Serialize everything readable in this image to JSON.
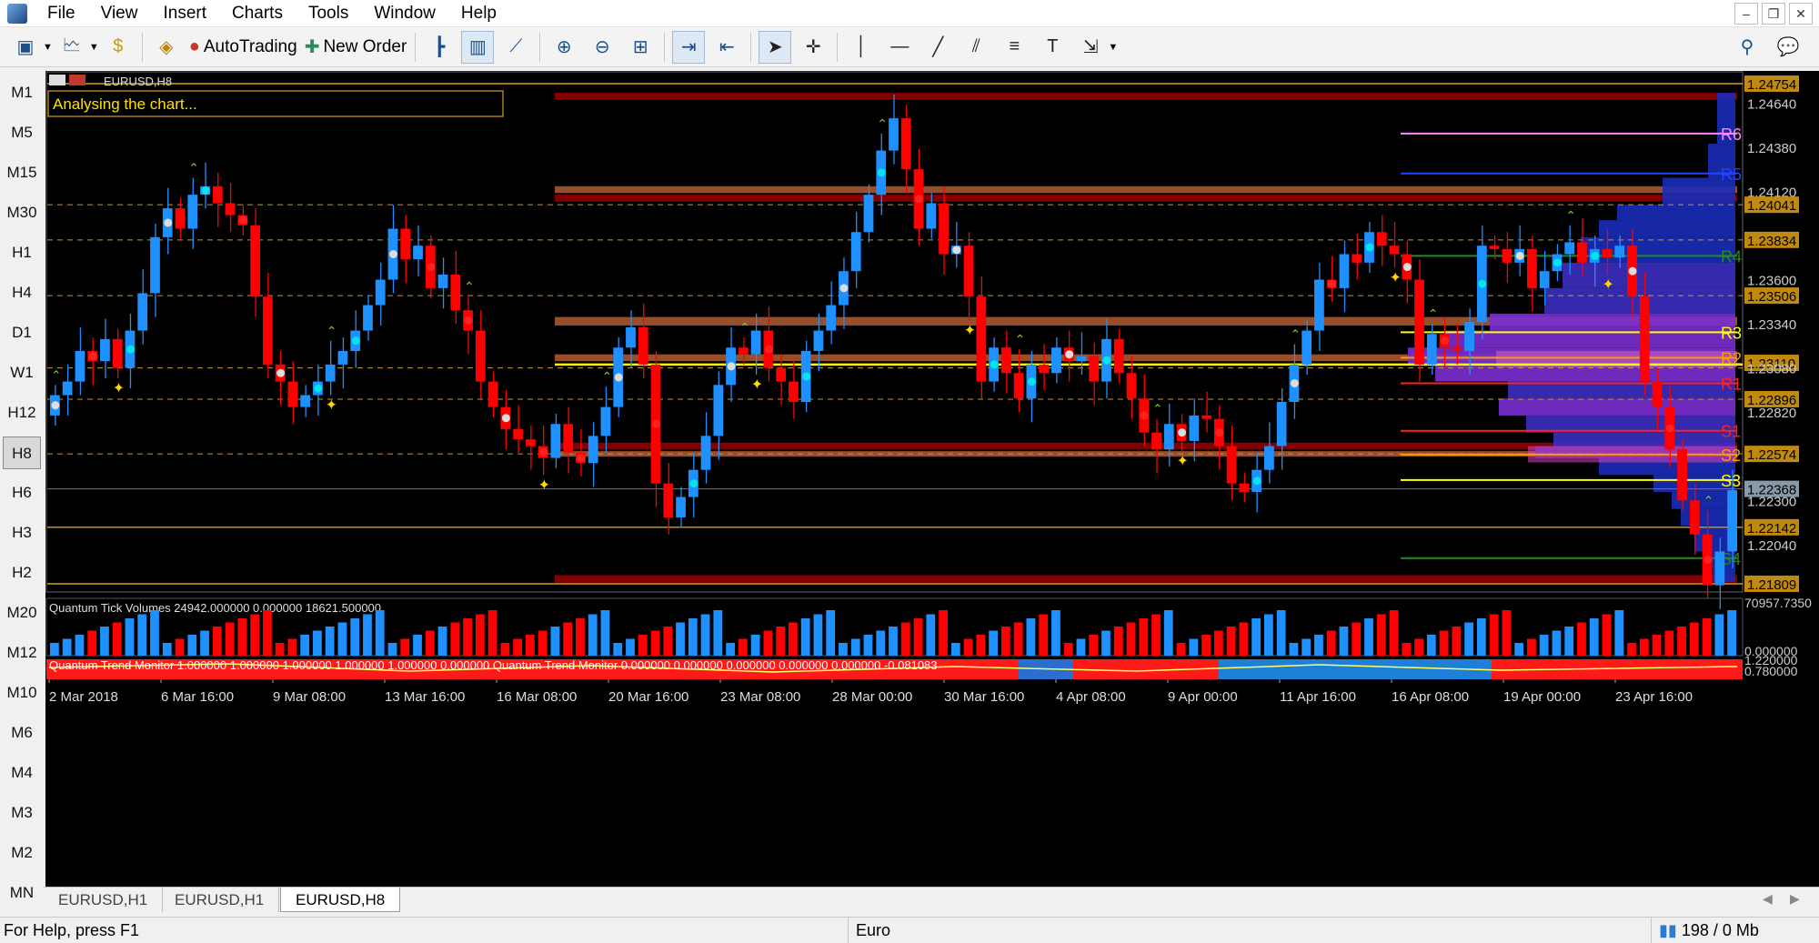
{
  "menu": [
    "File",
    "View",
    "Insert",
    "Charts",
    "Tools",
    "Window",
    "Help"
  ],
  "toolbar": {
    "autotrading_label": "AutoTrading",
    "new_order_label": "New Order"
  },
  "timeframes": [
    "M1",
    "M5",
    "M15",
    "M30",
    "H1",
    "H4",
    "D1",
    "W1",
    "H12",
    "H8",
    "H6",
    "H3",
    "H2",
    "M20",
    "M12",
    "M10",
    "M6",
    "M4",
    "M3",
    "M2",
    "MN"
  ],
  "active_timeframe": "H8",
  "chart": {
    "symbol_label": "EURUSD,H8",
    "status_banner": "Analysing the chart...",
    "price_labels": [
      "1.24754",
      "1.24640",
      "1.24380",
      "1.24120",
      "1.24041",
      "1.23834",
      "1.23600",
      "1.23506",
      "1.23340",
      "1.23110",
      "1.23080",
      "1.22896",
      "1.22820",
      "1.22574",
      "1.22368",
      "1.22300",
      "1.22142",
      "1.22040",
      "1.21809"
    ],
    "pivot_labels": [
      "R6",
      "R5",
      "R4",
      "R3",
      "R2",
      "R1",
      "S1",
      "S2",
      "S3",
      "S4"
    ],
    "date_labels": [
      "2 Mar 2018",
      "6 Mar 16:00",
      "9 Mar 08:00",
      "13 Mar 16:00",
      "16 Mar 08:00",
      "20 Mar 16:00",
      "23 Mar 08:00",
      "28 Mar 00:00",
      "30 Mar 16:00",
      "4 Apr 08:00",
      "9 Apr 00:00",
      "11 Apr 16:00",
      "16 Apr 08:00",
      "19 Apr 00:00",
      "23 Apr 16:00"
    ],
    "volume_indicator_label": "Quantum Tick Volumes 24942.000000 0.000000 18621.500000",
    "volume_scale_top": "70957.7350",
    "volume_scale_bottom": "0.000000",
    "trend_indicator_label": "Quantum Trend Monitor 1.000000 1.000000 1.000000 1.000000 1.000000 0.000000 Quantum Trend Monitor 0.000000 0.000000 0.000000 0.000000 0.000000 -0.081083",
    "trend_scale_top": "1.220000",
    "trend_scale_bottom": "0.780000",
    "colors": {
      "bull": "#1e90ff",
      "bear": "#ff0000",
      "background": "#000000",
      "grid": "#c89632",
      "pivot_yellow": "#ffff00"
    }
  },
  "tabs": [
    "EURUSD,H1",
    "EURUSD,H1",
    "EURUSD,H8"
  ],
  "status": {
    "help": "For Help, press F1",
    "profile": "Euro",
    "traffic": "198 / 0 Mb"
  }
}
